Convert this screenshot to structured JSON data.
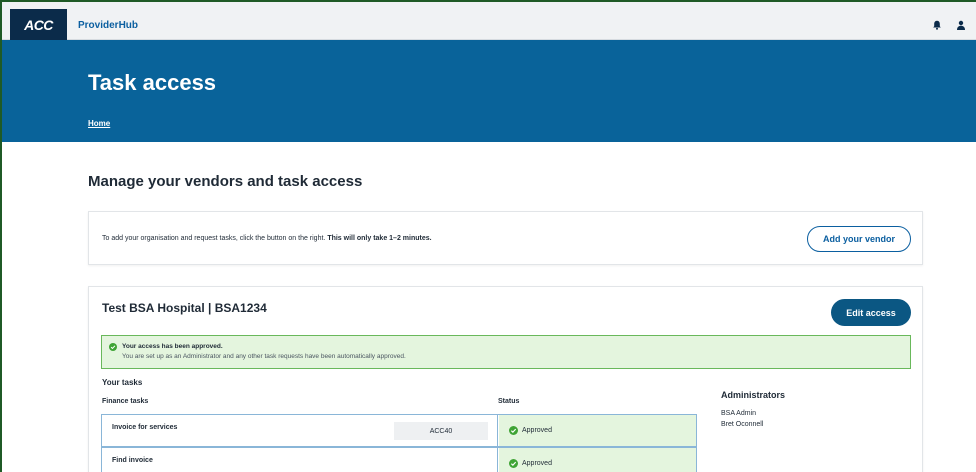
{
  "header": {
    "logo_text": "ACC",
    "app_name": "ProviderHub"
  },
  "hero": {
    "title": "Task access",
    "breadcrumb": "Home"
  },
  "main": {
    "section_title": "Manage your vendors and task access",
    "add_vendor_card": {
      "text": "To add your organisation and request tasks, click the button on the right.",
      "text_bold": "This will only take 1–2 minutes.",
      "button_label": "Add your vendor"
    },
    "vendor_card": {
      "title": "Test BSA Hospital | BSA1234",
      "edit_button_label": "Edit access",
      "alert": {
        "title": "Your access has been approved.",
        "body": "You are set up as an Administrator and any other task requests have been automatically approved."
      },
      "tasks_title": "Your tasks",
      "columns": {
        "finance": "Finance tasks",
        "status": "Status"
      },
      "tasks": [
        {
          "name": "Invoice for services",
          "code": "ACC40",
          "status": "Approved"
        },
        {
          "name": "Find invoice",
          "code": "",
          "status": "Approved"
        }
      ],
      "administrators": {
        "title": "Administrators",
        "names": [
          "BSA Admin",
          "Bret Oconnell"
        ]
      }
    }
  },
  "colors": {
    "hero_bg": "#09639a",
    "primary_button": "#0b5783",
    "success_bg": "#e4f5de",
    "success_border": "#69b85b",
    "success_icon": "#3fa435"
  }
}
